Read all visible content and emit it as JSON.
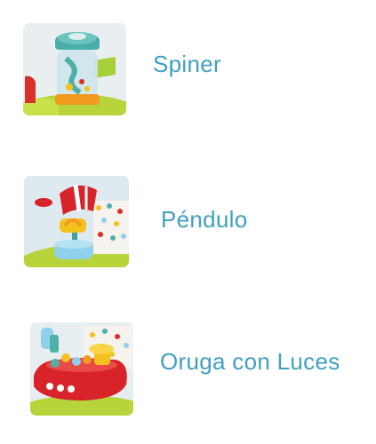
{
  "features": [
    {
      "label": "Spiner",
      "image_subject": "spinner-toy"
    },
    {
      "label": "Péndulo",
      "image_subject": "pendulum-toy"
    },
    {
      "label": "Oruga con Luces",
      "image_subject": "caterpillar-lights-toy"
    }
  ],
  "colors": {
    "label_text": "#3f9fc1",
    "background": "#ffffff",
    "toy_green": "#b7d43a",
    "toy_teal": "#4fb0a8",
    "toy_red": "#d8232a",
    "toy_yellow": "#f4c21f",
    "toy_blue": "#8fd0ec"
  }
}
